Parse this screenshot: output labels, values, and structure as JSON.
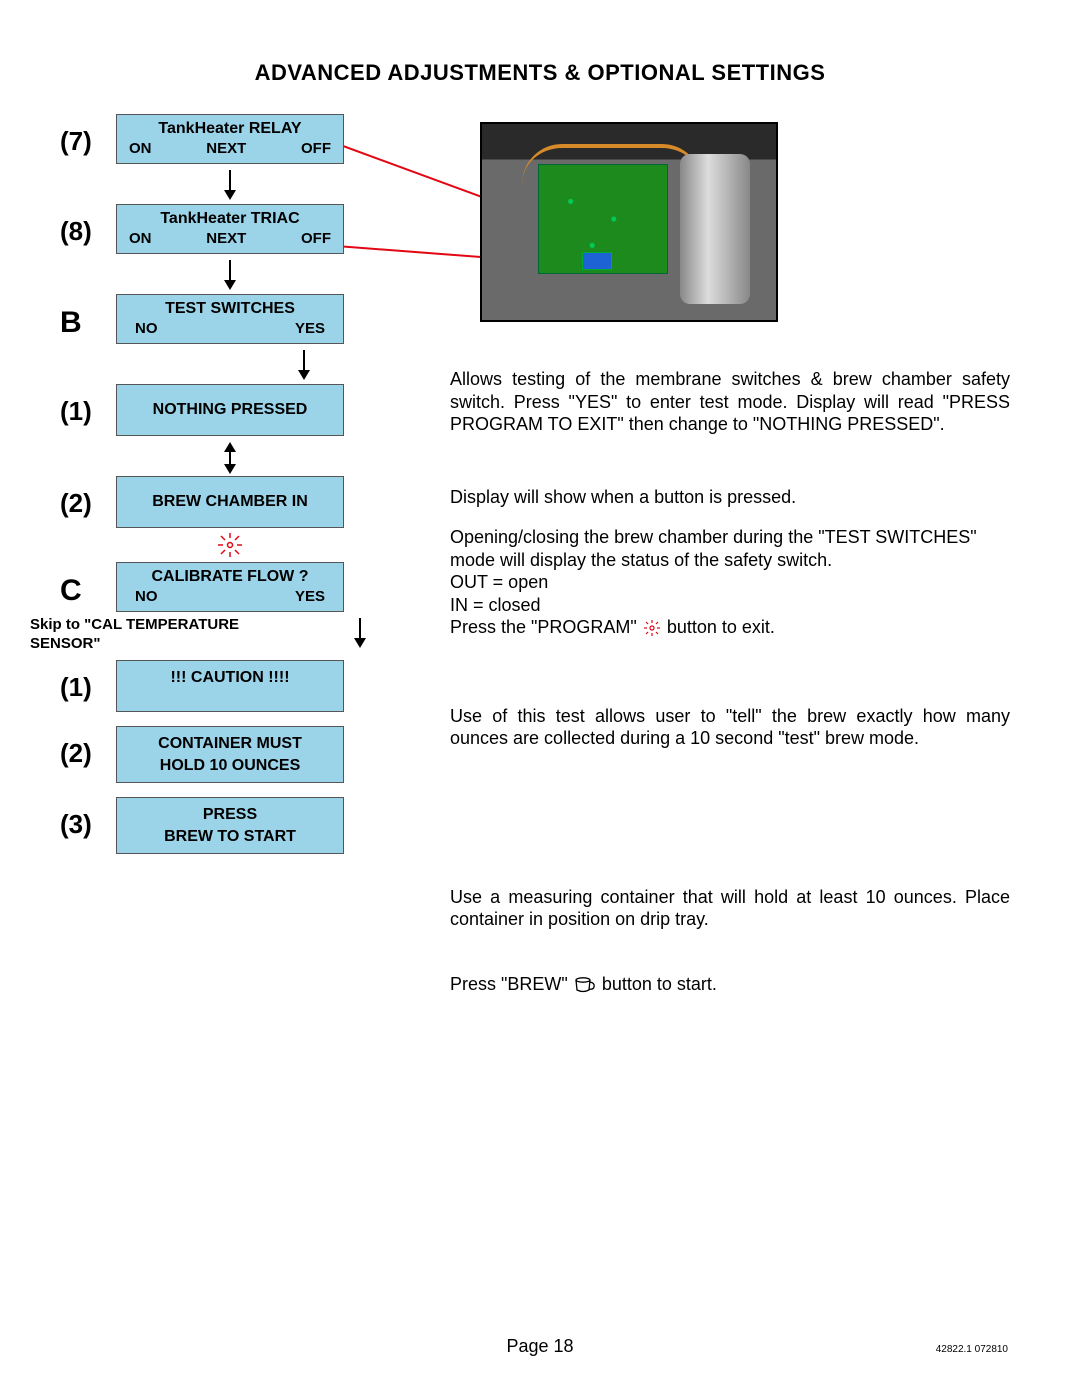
{
  "title": "ADVANCED ADJUSTMENTS & OPTIONAL SETTINGS",
  "steps": {
    "s7": {
      "num": "(7)",
      "title": "TankHeater RELAY",
      "opts": [
        "ON",
        "NEXT",
        "OFF"
      ]
    },
    "s8": {
      "num": "(8)",
      "title": "TankHeater TRIAC",
      "opts": [
        "ON",
        "NEXT",
        "OFF"
      ]
    },
    "sB": {
      "num": "B",
      "title": "TEST SWITCHES",
      "opts2": [
        "NO",
        "YES"
      ]
    },
    "sB1": {
      "num": "(1)",
      "single": "NOTHING PRESSED"
    },
    "sB2": {
      "num": "(2)",
      "single": "BREW CHAMBER IN"
    },
    "sC": {
      "num": "C",
      "title": "CALIBRATE FLOW ?",
      "opts2": [
        "NO",
        "YES"
      ]
    },
    "sC_note": "Skip to \"CAL TEMPERATURE SENSOR\"",
    "sC1": {
      "num": "(1)",
      "single": "!!! CAUTION !!!!"
    },
    "sC2": {
      "num": "(2)",
      "line1": "CONTAINER MUST",
      "line2": "HOLD 10 OUNCES"
    },
    "sC3": {
      "num": "(3)",
      "line1": "PRESS",
      "line2": "BREW TO START"
    }
  },
  "right": {
    "p1": "Allows testing of the membrane switches & brew chamber safety switch. Press \"YES\" to enter test mode. Display will read \"PRESS PROGRAM TO EXIT\" then change to \"NOTHING PRESSED\".",
    "p2": "Display will show when a button is pressed.",
    "p3a": "Opening/closing the brew chamber during the \"TEST SWITCHES\" mode will display the status of the safety switch.",
    "p3b": "OUT = open",
    "p3c": "IN = closed",
    "p3d_pre": "Press the \"PROGRAM\" ",
    "p3d_post": " button to exit.",
    "p4": "Use of this test allows user to \"tell\" the brew exactly how many ounces are collected during a 10 second \"test\" brew mode.",
    "p5": "Use a measuring container that will hold at least 10 ounces. Place container in position on drip tray.",
    "p6_pre": "Press \"BREW\" ",
    "p6_post": " button to start."
  },
  "footer": {
    "page": "Page 18",
    "code": "42822.1 072810"
  },
  "icons": {
    "program": "program-sun-icon",
    "brew": "cup-icon"
  }
}
